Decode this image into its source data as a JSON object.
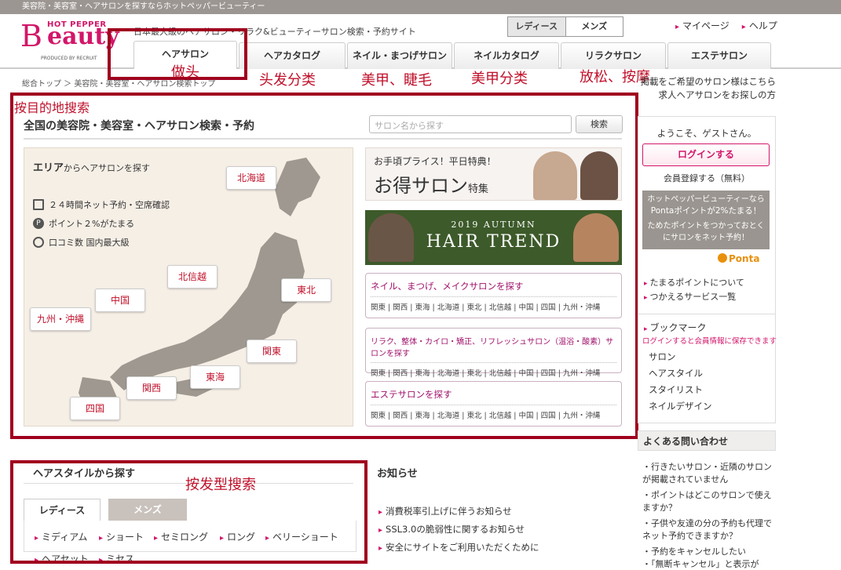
{
  "topbar": {
    "text": "美容院・美容室・ヘアサロンを探すならホットペッパービューティー"
  },
  "logo": {
    "small": "HOT PEPPER",
    "b": "B",
    "main": "eauty",
    "sub": "PRODUCED BY RECRUIT"
  },
  "tagline": "日本最大級のヘアサロン・リラク&ビューティーサロン検索・予約サイト",
  "gender": {
    "ladies": "レディース",
    "mens": "メンズ"
  },
  "toplinks": [
    "マイページ",
    "ヘルプ"
  ],
  "tabs": [
    "ヘアサロン",
    "ヘアカタログ",
    "ネイル・まつげサロン",
    "ネイルカタログ",
    "リラクサロン",
    "エステサロン"
  ],
  "annotations": {
    "hair": "做头",
    "catalog": "头发分类",
    "nail": "美甲、睫毛",
    "nailcat": "美甲分类",
    "relax": "放松、按摩",
    "dest": "按目的地搜索",
    "style": "按发型搜索"
  },
  "breadcrumb": "総合トップ ＞ 美容院・美容室・ヘアサロン検索トップ",
  "rightlinks": [
    "掲載をご希望のサロン様はこちら",
    "求人ヘアサロンをお探しの方"
  ],
  "main": {
    "title": "全国の美容院・美容室・ヘアサロン検索・予約",
    "search_placeholder": "サロン名から探す",
    "search_button": "検索"
  },
  "area": {
    "heading": "エリア",
    "heading_small": "からヘアサロンを探す",
    "features": [
      "２４時間ネット予約・空席確認",
      "ポイント２%がたまる",
      "口コミ数 国内最大級"
    ],
    "regions": {
      "hokkaido": "北海道",
      "tohoku": "東北",
      "hokushinetsu": "北信越",
      "kanto": "関東",
      "tokai": "東海",
      "kansai": "関西",
      "chugoku": "中国",
      "shikoku": "四国",
      "kyushu": "九州・沖縄"
    }
  },
  "banners": {
    "b1_top": "お手頃プライス！平日特典！",
    "b1_main": "お得サロン",
    "b1_suffix": "特集",
    "b2_small": "2019 AUTUMN",
    "b2_main": "HAIR TREND"
  },
  "categories": [
    {
      "title": "ネイル、まつげ、メイクサロンを探す",
      "regions": "関東 | 関西 | 東海 | 北海道 | 東北 | 北信越 | 中国 | 四国 | 九州・沖縄"
    },
    {
      "title": "リラク、整体・カイロ・矯正、リフレッシュサロン（温浴・酸素）サロンを探す",
      "regions": "関東 | 関西 | 東海 | 北海道 | 東北 | 北信越 | 中国 | 四国 | 九州・沖縄"
    },
    {
      "title": "エステサロンを探す",
      "regions": "関東 | 関西 | 東海 | 北海道 | 東北 | 北信越 | 中国 | 四国 | 九州・沖縄"
    }
  ],
  "sidebar": {
    "welcome": "ようこそ、ゲストさん。",
    "login": "ログインする",
    "register": "会員登録する（無料）",
    "ponta_l1": "ホットペッパービューティーなら",
    "ponta_l2": "Pontaポイントが2%たまる！",
    "ponta_l3": "ためたポイントをつかっておとく",
    "ponta_l4": "にサロンをネット予約！",
    "ponta_logo": "Ponta",
    "links": [
      "たまるポイントについて",
      "つかえるサービス一覧"
    ],
    "bookmark": "ブックマーク",
    "bookmark_note": "ログインすると会員情報に保存できます",
    "bookmark_items": [
      "サロン",
      "ヘアスタイル",
      "スタイリスト",
      "ネイルデザイン"
    ],
    "faq_title": "よくある問い合わせ",
    "faq": [
      "行きたいサロン・近隣のサロンが掲載されていません",
      "ポイントはどこのサロンで使えますか？",
      "子供や友達の分の予約も代理でネット予約できますか？",
      "予約をキャンセルしたい",
      "「無断キャンセル」と表示が"
    ]
  },
  "hairstyle": {
    "title": "ヘアスタイルから探す",
    "tab_ladies": "レディース",
    "tab_mens": "メンズ",
    "styles": [
      "ミディアム",
      "ショート",
      "セミロング",
      "ロング",
      "ベリーショート",
      "ヘアセット",
      "ミセス"
    ]
  },
  "news": {
    "title": "お知らせ",
    "items": [
      "消費税率引上げに伴うお知らせ",
      "SSL3.0の脆弱性に関するお知らせ",
      "安全にサイトをご利用いただくために"
    ]
  },
  "colors": {
    "brand": "#d2166a",
    "annotation": "#a0001e"
  }
}
